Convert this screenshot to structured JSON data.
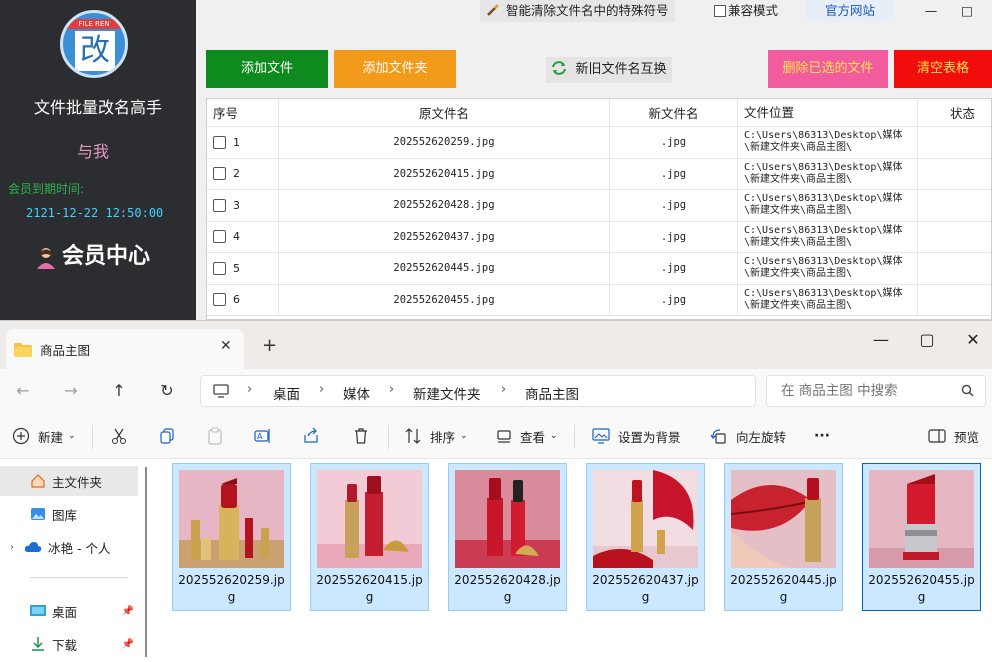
{
  "app": {
    "logo_banner": "FILE REN",
    "logo_char": "改",
    "name": "文件批量改名高手",
    "user": "与我",
    "member_expire_label": "会员到期时间:",
    "member_expire_value": "2121-12-22 12:50:00",
    "member_center": "会员中心",
    "top_toolbar": {
      "clean_special": "智能清除文件名中的特殊符号",
      "compat_mode": "兼容模式",
      "official_site": "官方网站",
      "win_min": "—",
      "win_max": "□"
    },
    "actions": {
      "add_file": "添加文件",
      "add_folder": "添加文件夹",
      "swap_names": "新旧文件名互换",
      "delete_selected": "删除已选的文件",
      "clear_table": "清空表格"
    },
    "table": {
      "headers": [
        "序号",
        "原文件名",
        "新文件名",
        "文件位置",
        "状态"
      ],
      "rows": [
        {
          "num": "1",
          "old": "202552620259.jpg",
          "new": ".jpg",
          "loc": "C:\\Users\\86313\\Desktop\\媒体\\新建文件夹\\商品主图\\",
          "status": ""
        },
        {
          "num": "2",
          "old": "202552620415.jpg",
          "new": ".jpg",
          "loc": "C:\\Users\\86313\\Desktop\\媒体\\新建文件夹\\商品主图\\",
          "status": ""
        },
        {
          "num": "3",
          "old": "202552620428.jpg",
          "new": ".jpg",
          "loc": "C:\\Users\\86313\\Desktop\\媒体\\新建文件夹\\商品主图\\",
          "status": ""
        },
        {
          "num": "4",
          "old": "202552620437.jpg",
          "new": ".jpg",
          "loc": "C:\\Users\\86313\\Desktop\\媒体\\新建文件夹\\商品主图\\",
          "status": ""
        },
        {
          "num": "5",
          "old": "202552620445.jpg",
          "new": ".jpg",
          "loc": "C:\\Users\\86313\\Desktop\\媒体\\新建文件夹\\商品主图\\",
          "status": ""
        },
        {
          "num": "6",
          "old": "202552620455.jpg",
          "new": ".jpg",
          "loc": "C:\\Users\\86313\\Desktop\\媒体\\新建文件夹\\商品主图\\",
          "status": ""
        }
      ]
    }
  },
  "explorer": {
    "tab_title": "商品主图",
    "tab_close": "✕",
    "new_tab": "+",
    "win_min": "—",
    "win_max": "▢",
    "win_close": "✕",
    "breadcrumb": [
      "桌面",
      "媒体",
      "新建文件夹",
      "商品主图"
    ],
    "search_placeholder": "在 商品主图 中搜索",
    "commands": {
      "new": "新建",
      "sort": "排序",
      "view": "查看",
      "set_background": "设置为背景",
      "rotate_left": "向左旋转",
      "more": "···",
      "preview": "预览"
    },
    "nav_pane": {
      "home": "主文件夹",
      "gallery": "图库",
      "cloud": "冰艳 - 个人",
      "desktop": "桌面",
      "downloads": "下载"
    },
    "files": [
      {
        "name": "202552620259.jpg"
      },
      {
        "name": "202552620415.jpg"
      },
      {
        "name": "202552620428.jpg"
      },
      {
        "name": "202552620437.jpg"
      },
      {
        "name": "202552620445.jpg"
      },
      {
        "name": "202552620455.jpg"
      }
    ]
  },
  "colors": {
    "sidebar_bg": "#2b2d31",
    "add_file": "#0f8a1f",
    "add_folder": "#f29b1a",
    "delete_selected": "#f25c9f",
    "clear_table": "#f20d0d",
    "selection": "#cce8ff"
  }
}
